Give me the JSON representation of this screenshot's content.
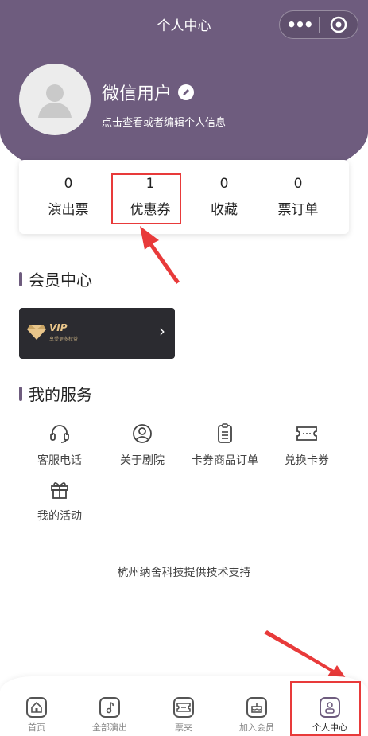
{
  "nav": {
    "title": "个人中心",
    "more_icon": "more-dots-icon",
    "close_icon": "target-circle-icon"
  },
  "profile": {
    "username": "微信用户",
    "subtitle": "点击查看或者编辑个人信息"
  },
  "stats": [
    {
      "count": "0",
      "label": "演出票"
    },
    {
      "count": "1",
      "label": "优惠券"
    },
    {
      "count": "0",
      "label": "收藏"
    },
    {
      "count": "0",
      "label": "票订单"
    }
  ],
  "member": {
    "title": "会员中心",
    "vip_label": "VIP",
    "vip_sub": "享受更多权益"
  },
  "services": {
    "title": "我的服务",
    "items": [
      {
        "label": "客服电话",
        "icon": "headset-icon"
      },
      {
        "label": "关于剧院",
        "icon": "user-circle-icon"
      },
      {
        "label": "卡券商品订单",
        "icon": "clipboard-icon"
      },
      {
        "label": "兑换卡券",
        "icon": "ticket-icon"
      },
      {
        "label": "我的活动",
        "icon": "gift-icon"
      }
    ]
  },
  "footer_text": "杭州纳舍科技提供技术支持",
  "tabbar": [
    {
      "label": "首页",
      "icon": "home-icon"
    },
    {
      "label": "全部演出",
      "icon": "music-note-icon"
    },
    {
      "label": "票夹",
      "icon": "ticket-folder-icon"
    },
    {
      "label": "加入会员",
      "icon": "cake-icon"
    },
    {
      "label": "个人中心",
      "icon": "person-icon"
    }
  ],
  "colors": {
    "brand": "#6e5c7e",
    "annotation": "#e83a3a",
    "vip_gold": "#e8c58a"
  }
}
